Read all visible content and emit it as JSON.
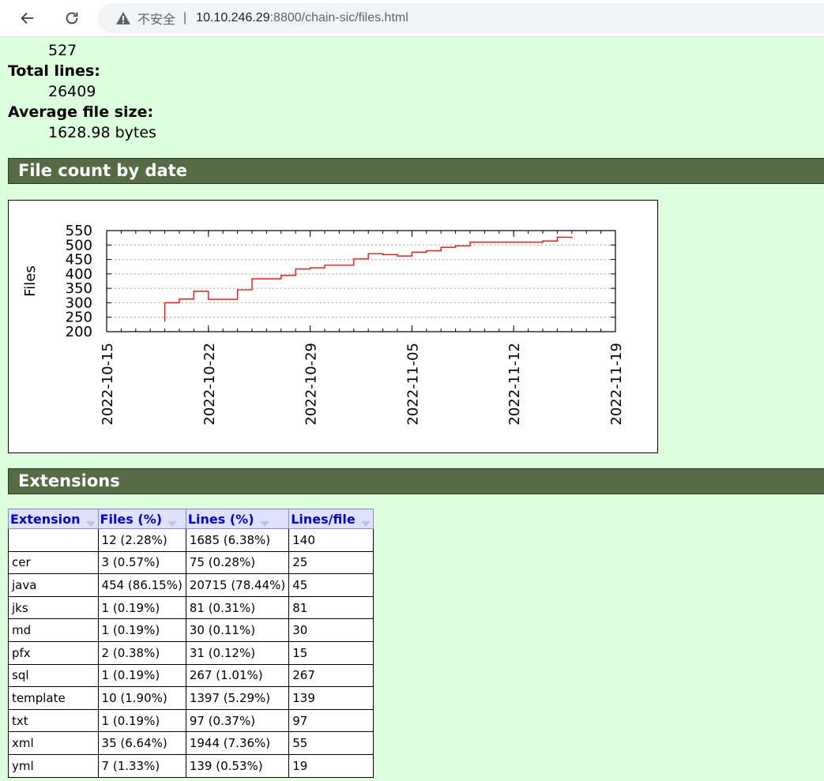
{
  "browser": {
    "insecure_label": "不安全",
    "separator": "|",
    "url_host": "10.10.246.29",
    "url_rest": ":8800/chain-sic/files.html"
  },
  "stats": {
    "total_files_value": "527",
    "total_lines_label": "Total lines:",
    "total_lines_value": "26409",
    "avg_size_label": "Average file size:",
    "avg_size_value": "1628.98 bytes"
  },
  "sections": {
    "file_count_title": "File count by date",
    "extensions_title": "Extensions"
  },
  "chart_data": {
    "type": "line",
    "title": "",
    "xlabel": "",
    "ylabel": "Files",
    "ylim": [
      200,
      550
    ],
    "yticks": [
      200,
      250,
      300,
      350,
      400,
      450,
      500,
      550
    ],
    "xticks": [
      "2022-10-15",
      "2022-10-22",
      "2022-10-29",
      "2022-11-05",
      "2022-11-12",
      "2022-11-19"
    ],
    "grid": "horizontal dashed",
    "series": [
      {
        "color": "#ff0000",
        "step": true,
        "points": [
          [
            "2022-10-19",
            235
          ],
          [
            "2022-10-19",
            300
          ],
          [
            "2022-10-20",
            300
          ],
          [
            "2022-10-20",
            313
          ],
          [
            "2022-10-21",
            313
          ],
          [
            "2022-10-21",
            340
          ],
          [
            "2022-10-22",
            340
          ],
          [
            "2022-10-22",
            312
          ],
          [
            "2022-10-24",
            312
          ],
          [
            "2022-10-24",
            345
          ],
          [
            "2022-10-25",
            345
          ],
          [
            "2022-10-25",
            383
          ],
          [
            "2022-10-27",
            383
          ],
          [
            "2022-10-27",
            395
          ],
          [
            "2022-10-28",
            395
          ],
          [
            "2022-10-28",
            417
          ],
          [
            "2022-10-29",
            417
          ],
          [
            "2022-10-29",
            421
          ],
          [
            "2022-10-30",
            421
          ],
          [
            "2022-10-30",
            430
          ],
          [
            "2022-11-01",
            430
          ],
          [
            "2022-11-01",
            452
          ],
          [
            "2022-11-02",
            452
          ],
          [
            "2022-11-02",
            470
          ],
          [
            "2022-11-03",
            470
          ],
          [
            "2022-11-03",
            467
          ],
          [
            "2022-11-04",
            467
          ],
          [
            "2022-11-04",
            462
          ],
          [
            "2022-11-05",
            462
          ],
          [
            "2022-11-05",
            475
          ],
          [
            "2022-11-06",
            475
          ],
          [
            "2022-11-06",
            480
          ],
          [
            "2022-11-07",
            480
          ],
          [
            "2022-11-07",
            492
          ],
          [
            "2022-11-08",
            492
          ],
          [
            "2022-11-08",
            497
          ],
          [
            "2022-11-09",
            497
          ],
          [
            "2022-11-09",
            510
          ],
          [
            "2022-11-14",
            510
          ],
          [
            "2022-11-14",
            514
          ],
          [
            "2022-11-15",
            514
          ],
          [
            "2022-11-15",
            527
          ],
          [
            "2022-11-16",
            527
          ],
          [
            "2022-11-16",
            524
          ]
        ]
      }
    ]
  },
  "extensions_table": {
    "headers": [
      "Extension",
      "Files (%)",
      "Lines (%)",
      "Lines/file"
    ],
    "rows": [
      [
        "",
        "12 (2.28%)",
        "1685 (6.38%)",
        "140"
      ],
      [
        "cer",
        "3 (0.57%)",
        "75 (0.28%)",
        "25"
      ],
      [
        "java",
        "454 (86.15%)",
        "20715 (78.44%)",
        "45"
      ],
      [
        "jks",
        "1 (0.19%)",
        "81 (0.31%)",
        "81"
      ],
      [
        "md",
        "1 (0.19%)",
        "30 (0.11%)",
        "30"
      ],
      [
        "pfx",
        "2 (0.38%)",
        "31 (0.12%)",
        "15"
      ],
      [
        "sql",
        "1 (0.19%)",
        "267 (1.01%)",
        "267"
      ],
      [
        "template",
        "10 (1.90%)",
        "1397 (5.29%)",
        "139"
      ],
      [
        "txt",
        "1 (0.19%)",
        "97 (0.37%)",
        "97"
      ],
      [
        "xml",
        "35 (6.64%)",
        "1944 (7.36%)",
        "55"
      ],
      [
        "yml",
        "7 (1.33%)",
        "139 (0.53%)",
        "19"
      ]
    ]
  }
}
